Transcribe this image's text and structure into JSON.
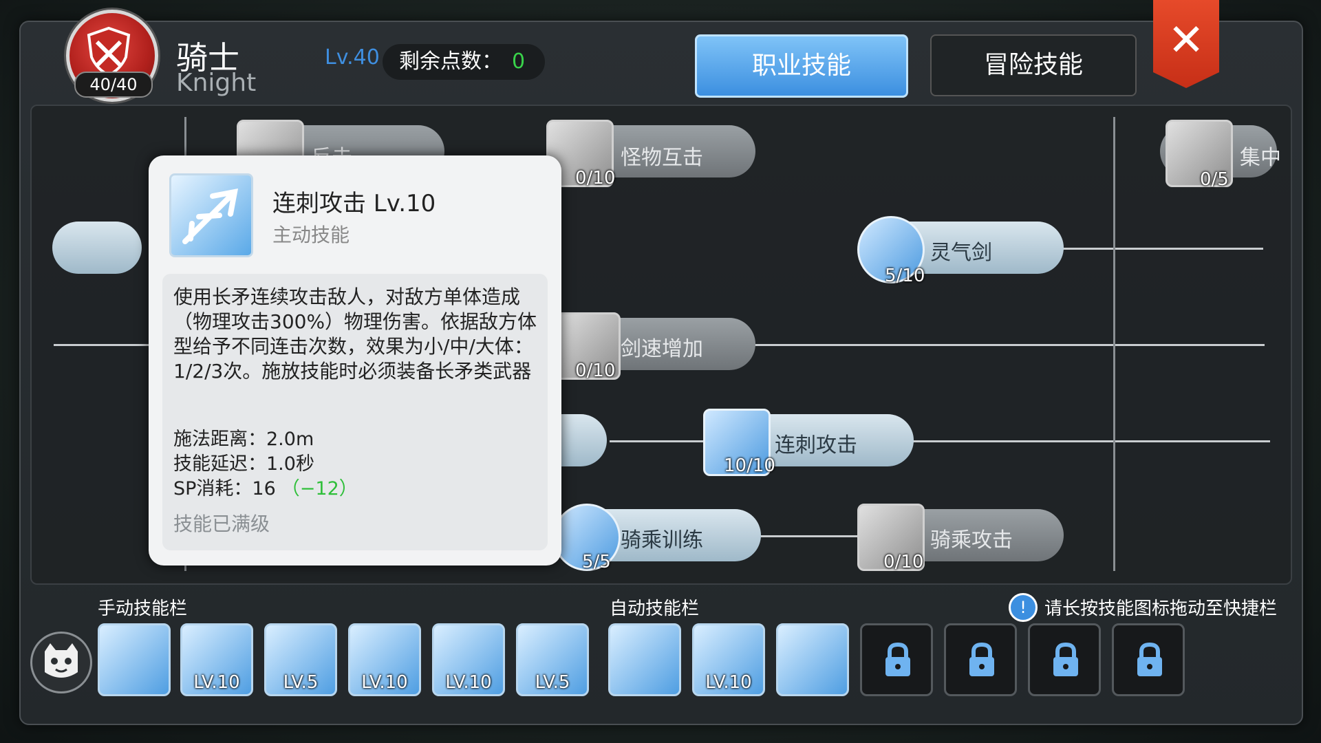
{
  "header": {
    "class_name": "骑士",
    "class_name_en": "Knight",
    "level": "Lv.40",
    "points_label": "剩余点数：",
    "points_value": "0",
    "emblem_count": "40/40",
    "tabs": [
      {
        "label": "职业技能",
        "active": true
      },
      {
        "label": "冒险技能",
        "active": false
      }
    ],
    "close_label": "✕"
  },
  "tree": {
    "nodes": [
      {
        "name": "反击",
        "count": "",
        "state": "locked"
      },
      {
        "name": "怪物互击",
        "count": "0/10",
        "state": "locked"
      },
      {
        "name": "集中",
        "count": "0/5",
        "state": "locked"
      },
      {
        "name": "灵气剑",
        "count": "5/10",
        "state": "learned"
      },
      {
        "name": "剑速增加",
        "count": "0/10",
        "state": "locked"
      },
      {
        "name": "连刺攻击",
        "count": "10/10",
        "state": "learned"
      },
      {
        "name": "骑乘训练",
        "count": "5/5",
        "state": "learned"
      },
      {
        "name": "骑乘攻击",
        "count": "0/10",
        "state": "locked"
      }
    ]
  },
  "popup": {
    "title": "连刺攻击  Lv.10",
    "type": "主动技能",
    "description": "使用长矛连续攻击敌人，对敌方单体造成（物理攻击300%）物理伤害。依据敌方体型给予不同连击次数，效果为小/中/大体：1/2/3次。施放技能时必须装备长矛类武器",
    "range": "施法距离：2.0m",
    "delay": "技能延迟：1.0秒",
    "sp_cost": "SP消耗：16",
    "sp_bonus": "（−12）",
    "max_text": "技能已满级"
  },
  "bars": {
    "manual_label": "手动技能栏",
    "auto_label": "自动技能栏",
    "hint": "请长按技能图标拖动至快捷栏",
    "manual_slots": [
      {
        "lv": ""
      },
      {
        "lv": "LV.10"
      },
      {
        "lv": "LV.5"
      },
      {
        "lv": "LV.10"
      },
      {
        "lv": "LV.10"
      },
      {
        "lv": "LV.5"
      }
    ],
    "auto_slots": [
      {
        "lv": ""
      },
      {
        "lv": "LV.10"
      },
      {
        "lv": ""
      }
    ],
    "locked_slots": 4
  },
  "colors": {
    "accent": "#3c8fe0",
    "close": "#e64a2a",
    "positive": "#2fbf3a"
  }
}
